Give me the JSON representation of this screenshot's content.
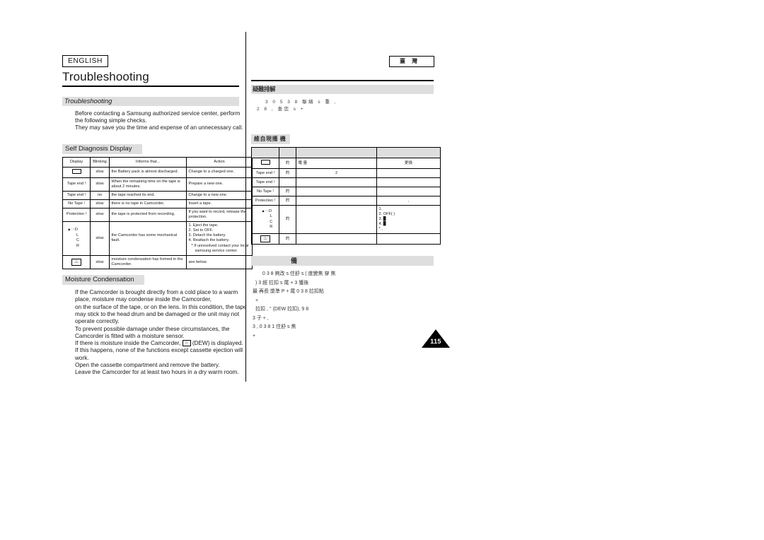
{
  "document": {
    "language_badge": "ENGLISH",
    "page_title": "Troubleshooting",
    "page_number": "115"
  },
  "left": {
    "section_bar": "Troubleshooting",
    "intro": [
      "Before contacting a Samsung authorized service center, perform",
      "the following simple checks.",
      "They may save you the time and expense of an unnecessary call."
    ],
    "self_diagnosis": {
      "label": "Self Diagnosis Display",
      "columns": [
        "Display",
        "Blinking",
        "Informs that...",
        "Action"
      ],
      "rows": [
        {
          "display": "battery-icon",
          "display_text": "",
          "blinking": "slow",
          "informs": "the Battery pack is almost discharged.",
          "action": "Change to a charged one."
        },
        {
          "display": "Tape end !",
          "blinking": "slow",
          "informs": "When the remaining time on the tape is about 2 minutes.",
          "action": "Prepare a new one."
        },
        {
          "display": "Tape end !",
          "blinking": "no",
          "informs": "the tape reached its end.",
          "action": "Change to a new one."
        },
        {
          "display": "No Tape !",
          "blinking": "slow",
          "informs": "there is no tape in Camcorder.",
          "action": "Insert a tape."
        },
        {
          "display": "Protection !",
          "blinking": "slow",
          "informs": "the tape is protected from recording.",
          "action": "If you want to record, release the protection."
        },
        {
          "display": "dlcr",
          "display_lines": [
            "D",
            "L",
            "C",
            "R"
          ],
          "blinking": "slow",
          "informs": "the Camcorder has some mechanical fault.",
          "action_lines": [
            "1. Eject the tape.",
            "2. Set to OFF.",
            "3. Detach the battery.",
            "4. Reattach the battery.",
            "* If unresolved contact your local",
            "samsung service center."
          ]
        },
        {
          "display": "dew-icon",
          "blinking": "slow",
          "informs": "moisture condensation has formed in the Camcorder.",
          "action": "see below."
        }
      ]
    },
    "moisture": {
      "label": "Moisture Condensation",
      "lines": [
        "If the Camcorder is brought directly from a cold place to a warm",
        "place, moisture may condense inside the Camcorder,",
        "on the surface of the tape, or on the lens. In this condition, the tape",
        "may stick to the head drum and be damaged or the unit may not",
        "operate correctly.",
        "To prevent possible damage under these circumstances, the",
        "Camcorder is fitted with a moisture sensor.",
        "If this happens, none of the functions except cassette ejection will",
        "work.",
        "Open the cassette compartment and remove the battery.",
        "Leave the Camcorder for at least two hours in a dry warm room."
      ],
      "dew_line_prefix": "If there is moisture inside the Camcorder,",
      "dew_line_suffix": "(DEW) is displayed."
    }
  },
  "right": {
    "language_badge_glyphs": "臺灣",
    "section_bar_glyphs": "疑難排解",
    "intro_line1": "3 0 5 3 8  聯絡 s 重 ,",
    "intro_line1b": ",",
    "intro_line2": "2 8    ,    查您  s    +",
    "sub_label_glyphs": "維自現播 機",
    "table": {
      "columns": [
        "",
        "",
        "",
        ""
      ],
      "rows": [
        {
          "display": "battery-icon",
          "blinking": "的",
          "informs": "電 量",
          "action": "更換"
        },
        {
          "display": "Tape end !",
          "blinking": "的",
          "informs": "2",
          "action": ""
        },
        {
          "display": "Tape end !",
          "blinking": "",
          "informs": "",
          "action": ""
        },
        {
          "display": "No Tape !",
          "blinking": "的",
          "informs": "",
          "action": ""
        },
        {
          "display": "Protection !",
          "blinking": "的",
          "informs": "",
          "action": ","
        },
        {
          "display": "dlcr",
          "display_lines": [
            "D",
            "L",
            "C",
            "R"
          ],
          "blinking": "的",
          "informs": "",
          "action_lines": [
            "1.",
            "2.      OFF(  )",
            "3.      ▉",
            "4.           ▉",
            "*                    ,"
          ]
        },
        {
          "display": "dew-icon",
          "blinking": "的",
          "informs": "",
          "action": ""
        }
      ]
    },
    "bar2_glyphs": "備",
    "body_lines": [
      "0 3 8    夠改 s            住舒 s   (   度變焦         穿    焦",
      ")    3              經                拉扣 s  尾 +  3              獲後",
      "最  再長 漿準        P  +              尾  0 3 8          拉扣粘",
      "+",
      "拉扣       , °         (DEW 拉扣),   9   8",
      "3                子 + ,",
      "3            ,  0 3 8 1           住舒 s 焦",
      "+"
    ]
  }
}
